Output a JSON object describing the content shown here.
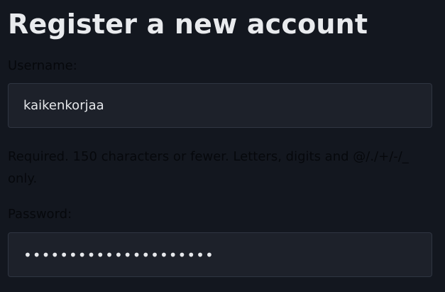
{
  "page": {
    "title": "Register a new account"
  },
  "form": {
    "username": {
      "label": "Username:",
      "value": "kaikenkorjaa",
      "help": "Required. 150 characters or fewer. Letters, digits and @/./+/-/_ only."
    },
    "password": {
      "label": "Password:",
      "value": "•••••••••••••••••••••"
    }
  },
  "colors": {
    "background": "#13171f",
    "input_background": "#1d212a",
    "input_border": "#2f3541",
    "title_text": "#e9ebee",
    "label_text": "#06080c"
  }
}
